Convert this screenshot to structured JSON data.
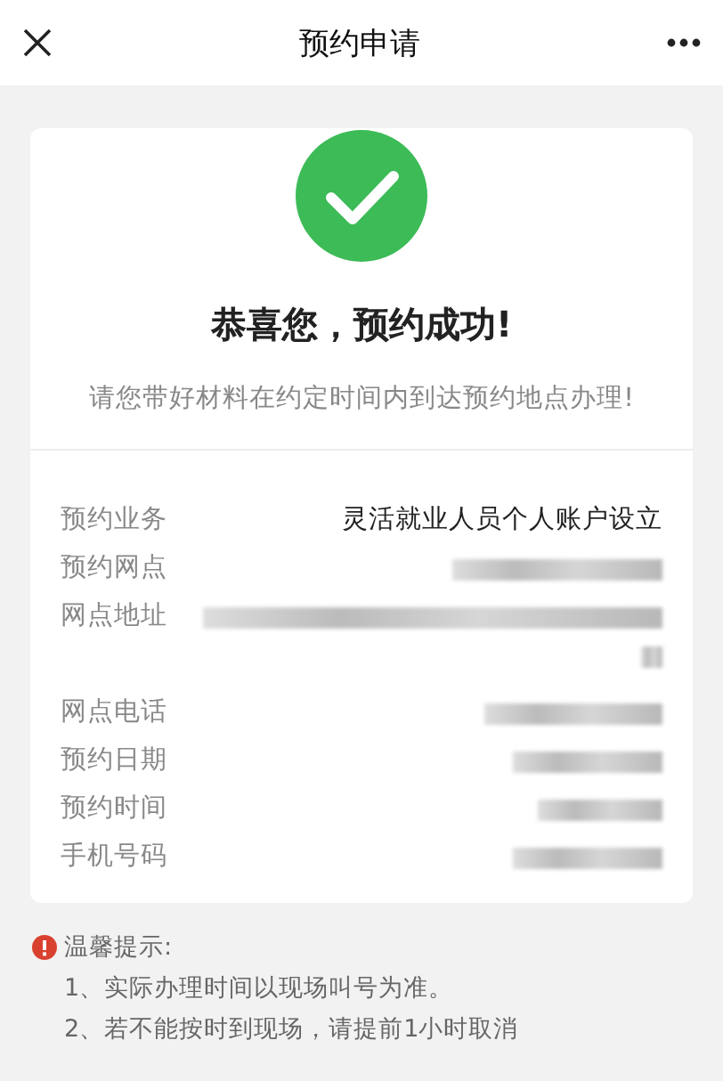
{
  "header": {
    "title": "预约申请"
  },
  "result": {
    "title": "恭喜您，预约成功!",
    "message": "请您带好材料在约定时间内到达预约地点办理!"
  },
  "details": [
    {
      "label": "预约业务",
      "kind": "text",
      "value": "灵活就业人员个人账户设立"
    },
    {
      "label": "预约网点",
      "kind": "redacted"
    },
    {
      "label": "网点地址",
      "kind": "redacted_long"
    },
    {
      "label": "网点电话",
      "kind": "redacted"
    },
    {
      "label": "预约日期",
      "kind": "redacted"
    },
    {
      "label": "预约时间",
      "kind": "redacted"
    },
    {
      "label": "手机号码",
      "kind": "redacted"
    }
  ],
  "notice": {
    "title": "温馨提示:",
    "lines": [
      "1、实际办理时间以现场叫号为准。",
      "2、若不能按时到现场，请提前1小时取消"
    ]
  }
}
